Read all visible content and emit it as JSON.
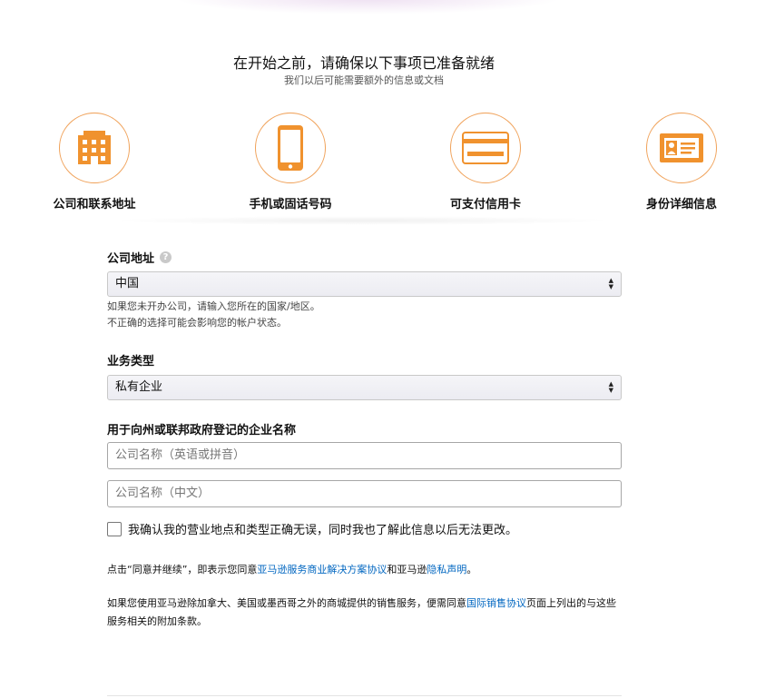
{
  "header": {
    "title": "在开始之前，请确保以下事项已准备就绪",
    "subtitle": "我们以后可能需要额外的信息或文档"
  },
  "steps": [
    {
      "icon": "building-icon",
      "label": "公司和联系地址"
    },
    {
      "icon": "phone-icon",
      "label": "手机或固话号码"
    },
    {
      "icon": "credit-card-icon",
      "label": "可支付信用卡"
    },
    {
      "icon": "id-card-icon",
      "label": "身份详细信息"
    }
  ],
  "colors": {
    "accent": "#f0922e",
    "link": "#0066c0"
  },
  "form": {
    "company_address": {
      "label": "公司地址",
      "help_icon": "?",
      "selected": "中国",
      "hint_line1": "如果您未开办公司，请输入您所在的国家/地区。",
      "hint_line2": "不正确的选择可能会影响您的帐户状态。"
    },
    "business_type": {
      "label": "业务类型",
      "selected": "私有企业"
    },
    "company_name": {
      "label": "用于向州或联邦政府登记的企业名称",
      "placeholder_en": "公司名称（英语或拼音）",
      "placeholder_cn": "公司名称（中文）"
    },
    "confirm": {
      "label": "我确认我的营业地点和类型正确无误，同时我也了解此信息以后无法更改。",
      "checked": false
    },
    "agreement": {
      "prefix": "点击“同意并继续”，即表示您同意",
      "link1": "亚马逊服务商业解决方案协议",
      "middle": "和亚马逊",
      "link2": "隐私声明",
      "suffix": "。"
    },
    "international": {
      "prefix": "如果您使用亚马逊除加拿大、美国或墨西哥之外的商城提供的销售服务，便需同意",
      "link": "国际销售协议",
      "suffix": "页面上列出的与这些服务相关的附加条款。"
    }
  }
}
